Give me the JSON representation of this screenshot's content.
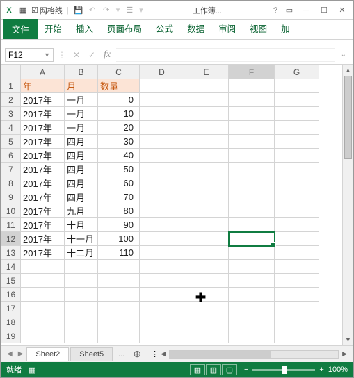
{
  "titlebar": {
    "gridlines_label": "网格线",
    "workbook_name": "工作簿..."
  },
  "ribbon": {
    "file": "文件",
    "tabs": [
      "开始",
      "插入",
      "页面布局",
      "公式",
      "数据",
      "审阅",
      "视图",
      "加"
    ]
  },
  "formula": {
    "name_box": "F12",
    "fx": "fx"
  },
  "cols": [
    "A",
    "B",
    "C",
    "D",
    "E",
    "F",
    "G"
  ],
  "headers": {
    "year": "年",
    "month": "月",
    "qty": "数量"
  },
  "rows": [
    {
      "year": "2017年",
      "month": "一月",
      "qty": "0"
    },
    {
      "year": "2017年",
      "month": "一月",
      "qty": "10"
    },
    {
      "year": "2017年",
      "month": "一月",
      "qty": "20"
    },
    {
      "year": "2017年",
      "month": "四月",
      "qty": "30"
    },
    {
      "year": "2017年",
      "month": "四月",
      "qty": "40"
    },
    {
      "year": "2017年",
      "month": "四月",
      "qty": "50"
    },
    {
      "year": "2017年",
      "month": "四月",
      "qty": "60"
    },
    {
      "year": "2017年",
      "month": "四月",
      "qty": "70"
    },
    {
      "year": "2017年",
      "month": "九月",
      "qty": "80"
    },
    {
      "year": "2017年",
      "month": "十月",
      "qty": "90"
    },
    {
      "year": "2017年",
      "month": "十一月",
      "qty": "100"
    },
    {
      "year": "2017年",
      "month": "十二月",
      "qty": "110"
    }
  ],
  "active_cell": "F12",
  "sheets": {
    "active": "Sheet2",
    "other": "Sheet5",
    "dots": "..."
  },
  "status": {
    "ready": "就绪",
    "zoom": "100%"
  }
}
